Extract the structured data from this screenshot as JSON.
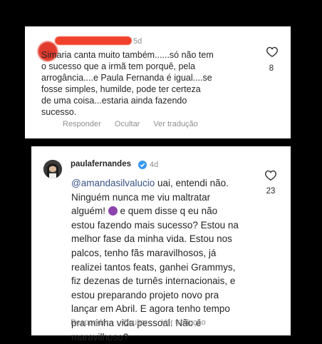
{
  "comment1": {
    "time": "5d",
    "lines": [
      "Simaria canta muito também......só não tem",
      "o sucesso que a irmã tem porquê,  pela",
      "arrogância....e Paula Fernanda é igual....se",
      "fosse simples,  humilde, pode ter certeza",
      "de uma coisa...estaria ainda fazendo",
      "sucesso."
    ],
    "reply": "Responder",
    "hide": "Ocultar",
    "translate": "Ver tradução",
    "likes": "8"
  },
  "comment2": {
    "username": "paulafernandes",
    "time": "4d",
    "mention": "@amandasilvalucio",
    "line1_rest": " uai, entendi não.",
    "line2": "Ninguém nunca me viu maltratar",
    "line3_a": "alguém! ",
    "line3_b": "  e quem disse q eu não",
    "lines": [
      "estou fazendo mais sucesso? Estou na",
      "melhor fase da minha vida. Estou nos",
      "palcos, tenho fãs maravilhosos, já",
      "realizei tantos feats, ganhei Grammys,",
      "fiz dezenas de turnês internacionais, e",
      "estou preparando projeto novo pra",
      "lançar em Abril. E agora tenho tempo",
      "pra minha vida pessoal. Não é",
      "maravilhoso?"
    ],
    "reply": "Responder",
    "hide": "Ocultar",
    "translate": "Ver tradução",
    "likes": "23"
  },
  "icons": {
    "heart": "heart-icon",
    "verified": "verified-badge-icon",
    "emoji": "woman-facepalm-emoji-icon"
  },
  "colors": {
    "mention": "#385185",
    "verified": "#3897f0",
    "muted": "#8e8e8e",
    "redaction": "#f0412c"
  }
}
